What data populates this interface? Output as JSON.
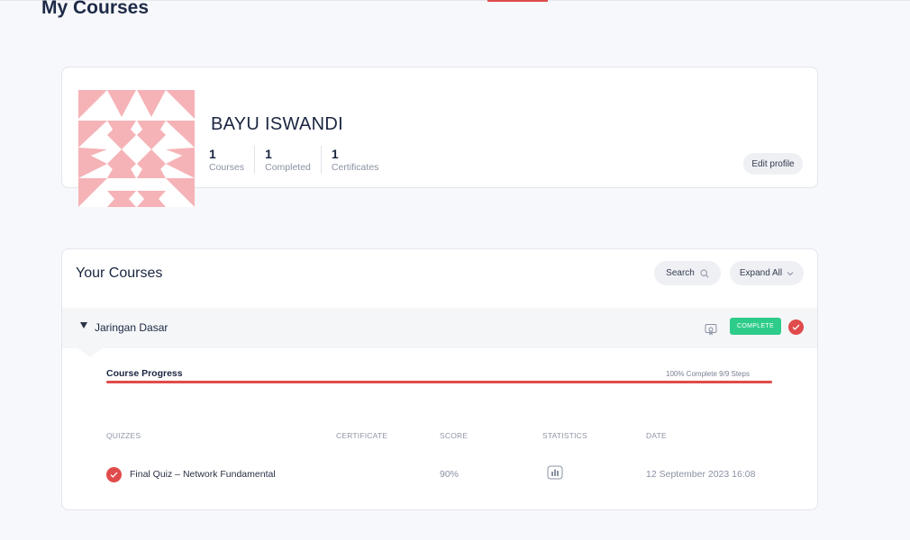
{
  "page": {
    "title": "My Courses"
  },
  "colors": {
    "accent": "#e04b4b",
    "complete": "#2ecc8a",
    "avatar_pattern": "#f5b3b7"
  },
  "profile": {
    "name": "BAYU ISWANDI",
    "stats": [
      {
        "value": "1",
        "label": "Courses"
      },
      {
        "value": "1",
        "label": "Completed"
      },
      {
        "value": "1",
        "label": "Certificates"
      }
    ],
    "edit_label": "Edit profile",
    "avatar_icon": "identicon-avatar"
  },
  "courses_section": {
    "title": "Your Courses",
    "search_label": "Search",
    "search_icon": "search-icon",
    "expand_label": "Expand All",
    "expand_icon": "chevron-down-icon"
  },
  "course": {
    "name": "Jaringan Dasar",
    "status_badge": "COMPLETE",
    "certificate_icon": "certificate-icon",
    "check_icon": "check-icon",
    "progress": {
      "title": "Course Progress",
      "meta": "100% Complete 9/9 Steps",
      "percent": 100
    }
  },
  "quiz_table": {
    "headers": {
      "quizzes": "QUIZZES",
      "certificate": "CERTIFICATE",
      "score": "SCORE",
      "statistics": "STATISTICS",
      "date": "DATE"
    },
    "rows": [
      {
        "quiz": "Final Quiz – Network Fundamental",
        "certificate": "",
        "score": "90%",
        "statistics_icon": "bar-chart-icon",
        "date": "12 September 2023 16:08"
      }
    ]
  }
}
